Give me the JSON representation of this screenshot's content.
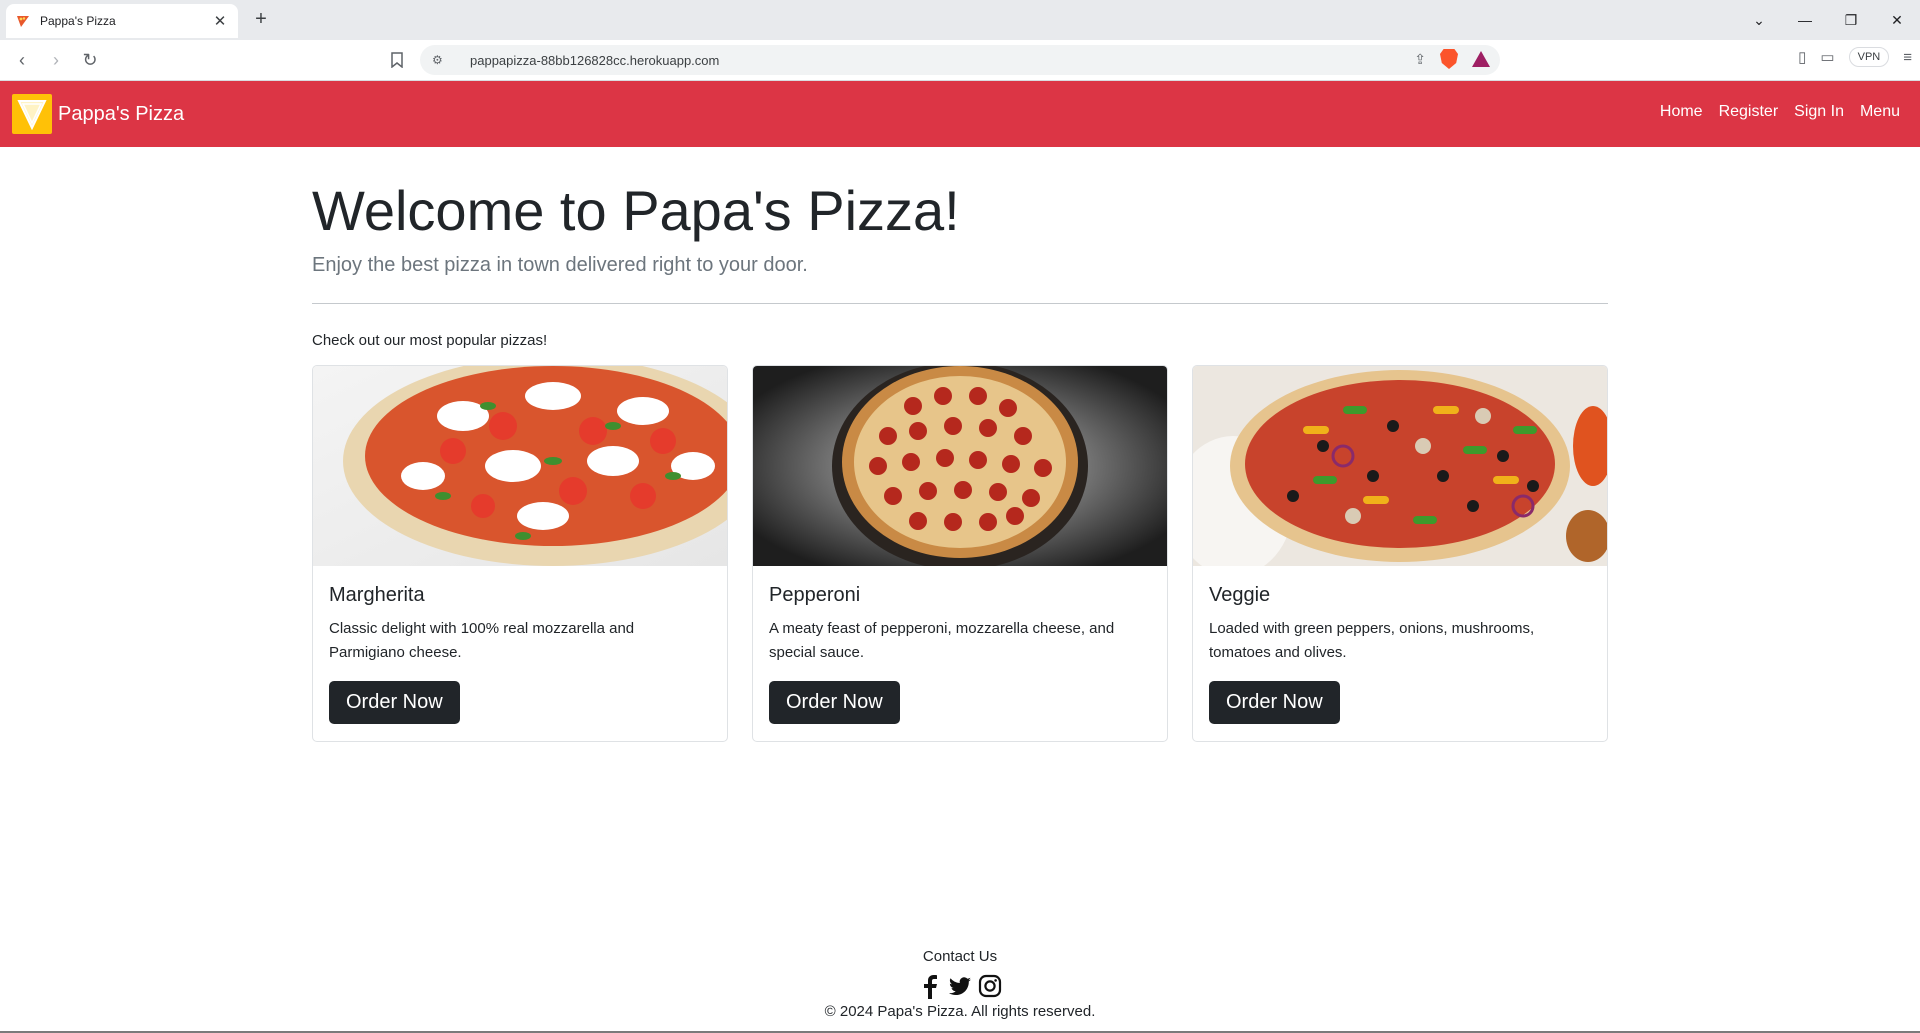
{
  "browser": {
    "tab_title": "Pappa's Pizza",
    "new_tab": "+",
    "url": "pappapizza-88bb126828cc.herokuapp.com",
    "vpn_label": "VPN"
  },
  "navbar": {
    "brand": "Pappa's Pizza",
    "links": [
      "Home",
      "Register",
      "Sign In",
      "Menu"
    ],
    "color": "#dc3545"
  },
  "hero": {
    "title": "Welcome to Papa's Pizza!",
    "subtitle": "Enjoy the best pizza in town delivered right to your door."
  },
  "section_label": "Check out our most popular pizzas!",
  "pizzas": [
    {
      "name": "Margherita",
      "description": "Classic delight with 100% real mozzarella and Parmigiano cheese.",
      "button": "Order Now"
    },
    {
      "name": "Pepperoni",
      "description": "A meaty feast of pepperoni, mozzarella cheese, and special sauce.",
      "button": "Order Now"
    },
    {
      "name": "Veggie",
      "description": "Loaded with green peppers, onions, mushrooms, tomatoes and olives.",
      "button": "Order Now"
    }
  ],
  "footer": {
    "contact": "Contact Us",
    "social_icons": [
      "facebook-icon",
      "twitter-icon",
      "instagram-icon"
    ],
    "copyright": "© 2024 Papa's Pizza. All rights reserved."
  }
}
